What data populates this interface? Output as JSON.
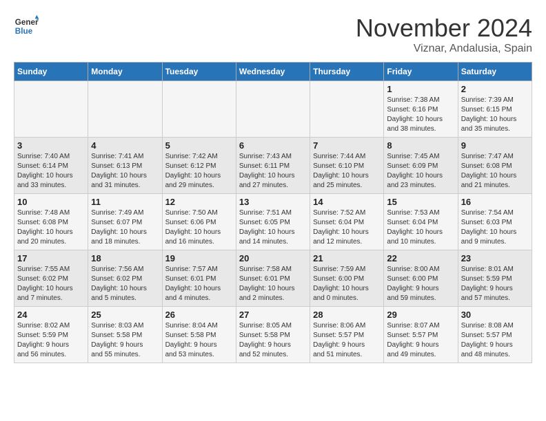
{
  "logo": {
    "line1": "General",
    "line2": "Blue"
  },
  "title": "November 2024",
  "location": "Viznar, Andalusia, Spain",
  "weekdays": [
    "Sunday",
    "Monday",
    "Tuesday",
    "Wednesday",
    "Thursday",
    "Friday",
    "Saturday"
  ],
  "weeks": [
    [
      {
        "day": "",
        "info": ""
      },
      {
        "day": "",
        "info": ""
      },
      {
        "day": "",
        "info": ""
      },
      {
        "day": "",
        "info": ""
      },
      {
        "day": "",
        "info": ""
      },
      {
        "day": "1",
        "info": "Sunrise: 7:38 AM\nSunset: 6:16 PM\nDaylight: 10 hours\nand 38 minutes."
      },
      {
        "day": "2",
        "info": "Sunrise: 7:39 AM\nSunset: 6:15 PM\nDaylight: 10 hours\nand 35 minutes."
      }
    ],
    [
      {
        "day": "3",
        "info": "Sunrise: 7:40 AM\nSunset: 6:14 PM\nDaylight: 10 hours\nand 33 minutes."
      },
      {
        "day": "4",
        "info": "Sunrise: 7:41 AM\nSunset: 6:13 PM\nDaylight: 10 hours\nand 31 minutes."
      },
      {
        "day": "5",
        "info": "Sunrise: 7:42 AM\nSunset: 6:12 PM\nDaylight: 10 hours\nand 29 minutes."
      },
      {
        "day": "6",
        "info": "Sunrise: 7:43 AM\nSunset: 6:11 PM\nDaylight: 10 hours\nand 27 minutes."
      },
      {
        "day": "7",
        "info": "Sunrise: 7:44 AM\nSunset: 6:10 PM\nDaylight: 10 hours\nand 25 minutes."
      },
      {
        "day": "8",
        "info": "Sunrise: 7:45 AM\nSunset: 6:09 PM\nDaylight: 10 hours\nand 23 minutes."
      },
      {
        "day": "9",
        "info": "Sunrise: 7:47 AM\nSunset: 6:08 PM\nDaylight: 10 hours\nand 21 minutes."
      }
    ],
    [
      {
        "day": "10",
        "info": "Sunrise: 7:48 AM\nSunset: 6:08 PM\nDaylight: 10 hours\nand 20 minutes."
      },
      {
        "day": "11",
        "info": "Sunrise: 7:49 AM\nSunset: 6:07 PM\nDaylight: 10 hours\nand 18 minutes."
      },
      {
        "day": "12",
        "info": "Sunrise: 7:50 AM\nSunset: 6:06 PM\nDaylight: 10 hours\nand 16 minutes."
      },
      {
        "day": "13",
        "info": "Sunrise: 7:51 AM\nSunset: 6:05 PM\nDaylight: 10 hours\nand 14 minutes."
      },
      {
        "day": "14",
        "info": "Sunrise: 7:52 AM\nSunset: 6:04 PM\nDaylight: 10 hours\nand 12 minutes."
      },
      {
        "day": "15",
        "info": "Sunrise: 7:53 AM\nSunset: 6:04 PM\nDaylight: 10 hours\nand 10 minutes."
      },
      {
        "day": "16",
        "info": "Sunrise: 7:54 AM\nSunset: 6:03 PM\nDaylight: 10 hours\nand 9 minutes."
      }
    ],
    [
      {
        "day": "17",
        "info": "Sunrise: 7:55 AM\nSunset: 6:02 PM\nDaylight: 10 hours\nand 7 minutes."
      },
      {
        "day": "18",
        "info": "Sunrise: 7:56 AM\nSunset: 6:02 PM\nDaylight: 10 hours\nand 5 minutes."
      },
      {
        "day": "19",
        "info": "Sunrise: 7:57 AM\nSunset: 6:01 PM\nDaylight: 10 hours\nand 4 minutes."
      },
      {
        "day": "20",
        "info": "Sunrise: 7:58 AM\nSunset: 6:01 PM\nDaylight: 10 hours\nand 2 minutes."
      },
      {
        "day": "21",
        "info": "Sunrise: 7:59 AM\nSunset: 6:00 PM\nDaylight: 10 hours\nand 0 minutes."
      },
      {
        "day": "22",
        "info": "Sunrise: 8:00 AM\nSunset: 6:00 PM\nDaylight: 9 hours\nand 59 minutes."
      },
      {
        "day": "23",
        "info": "Sunrise: 8:01 AM\nSunset: 5:59 PM\nDaylight: 9 hours\nand 57 minutes."
      }
    ],
    [
      {
        "day": "24",
        "info": "Sunrise: 8:02 AM\nSunset: 5:59 PM\nDaylight: 9 hours\nand 56 minutes."
      },
      {
        "day": "25",
        "info": "Sunrise: 8:03 AM\nSunset: 5:58 PM\nDaylight: 9 hours\nand 55 minutes."
      },
      {
        "day": "26",
        "info": "Sunrise: 8:04 AM\nSunset: 5:58 PM\nDaylight: 9 hours\nand 53 minutes."
      },
      {
        "day": "27",
        "info": "Sunrise: 8:05 AM\nSunset: 5:58 PM\nDaylight: 9 hours\nand 52 minutes."
      },
      {
        "day": "28",
        "info": "Sunrise: 8:06 AM\nSunset: 5:57 PM\nDaylight: 9 hours\nand 51 minutes."
      },
      {
        "day": "29",
        "info": "Sunrise: 8:07 AM\nSunset: 5:57 PM\nDaylight: 9 hours\nand 49 minutes."
      },
      {
        "day": "30",
        "info": "Sunrise: 8:08 AM\nSunset: 5:57 PM\nDaylight: 9 hours\nand 48 minutes."
      }
    ]
  ]
}
